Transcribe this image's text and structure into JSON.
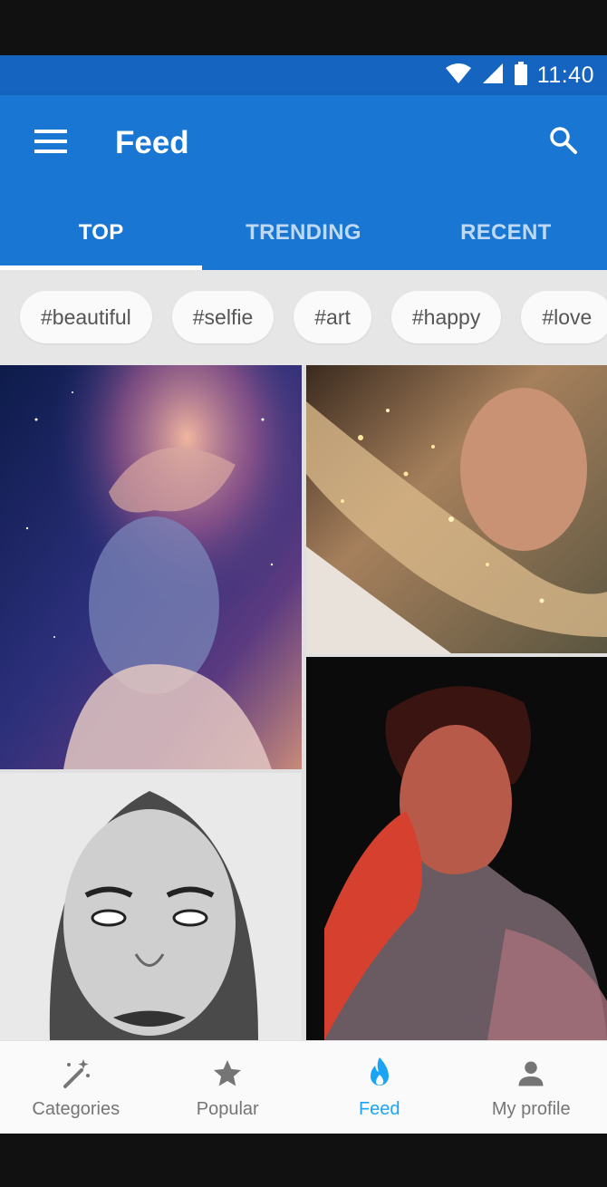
{
  "status_bar": {
    "time": "11:40",
    "icons": [
      "wifi-icon",
      "signal-icon",
      "battery-icon"
    ]
  },
  "toolbar": {
    "title": "Feed",
    "menu_icon": "hamburger-menu-icon",
    "search_icon": "search-icon"
  },
  "tabs": [
    {
      "label": "TOP",
      "active": true
    },
    {
      "label": "TRENDING",
      "active": false
    },
    {
      "label": "RECENT",
      "active": false
    }
  ],
  "hashtags": [
    "#beautiful",
    "#selfie",
    "#art",
    "#happy",
    "#love"
  ],
  "feed": {
    "items": [
      {
        "style": "galaxy double-exposure portrait"
      },
      {
        "style": "sparkle glitter hair portrait"
      },
      {
        "style": "monochrome sketch portrait"
      },
      {
        "style": "red neon portrait"
      }
    ]
  },
  "bottom_nav": {
    "items": [
      {
        "label": "Categories",
        "icon": "magic-wand-icon",
        "active": false
      },
      {
        "label": "Popular",
        "icon": "star-icon",
        "active": false
      },
      {
        "label": "Feed",
        "icon": "flame-icon",
        "active": true
      },
      {
        "label": "My profile",
        "icon": "person-icon",
        "active": false
      }
    ]
  },
  "colors": {
    "primary": "#1976d2",
    "status_bar": "#1565c0",
    "active_nav": "#1ba4f4"
  }
}
